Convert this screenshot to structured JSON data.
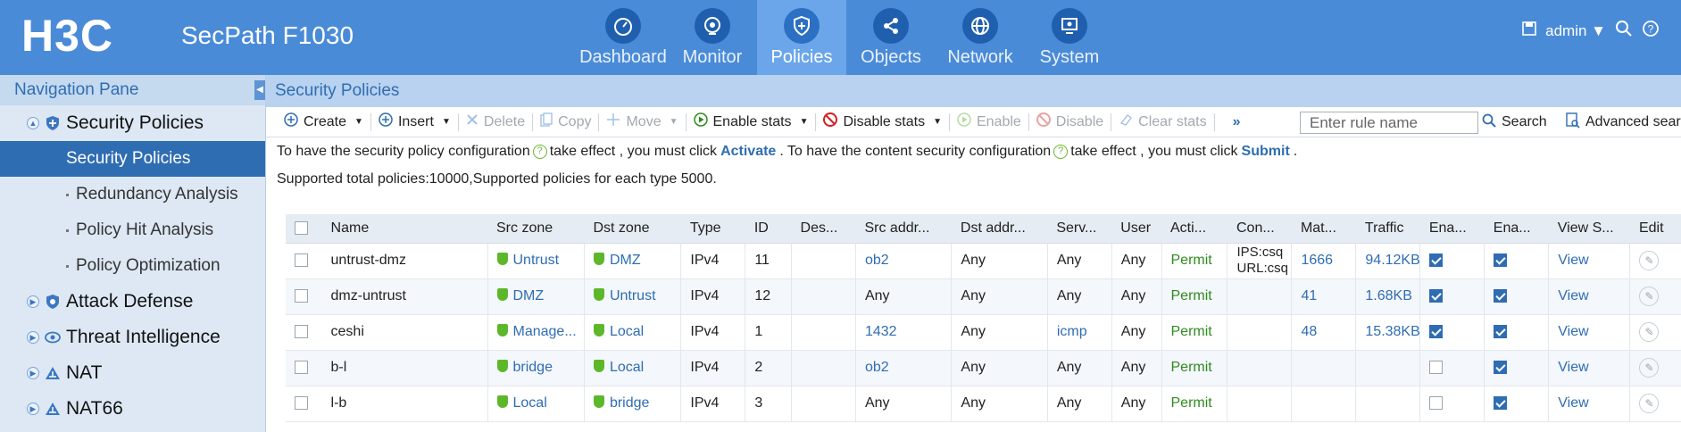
{
  "header": {
    "logo": "H3C",
    "product": "SecPath F1030",
    "nav": [
      {
        "label": "Dashboard",
        "icon": "dashboard-icon"
      },
      {
        "label": "Monitor",
        "icon": "monitor-icon"
      },
      {
        "label": "Policies",
        "icon": "policies-icon",
        "active": true
      },
      {
        "label": "Objects",
        "icon": "objects-icon"
      },
      {
        "label": "Network",
        "icon": "network-icon"
      },
      {
        "label": "System",
        "icon": "system-icon"
      }
    ],
    "user": "admin"
  },
  "sidebar": {
    "title": "Navigation Pane",
    "items": [
      {
        "label": "Security Policies",
        "level": 1
      },
      {
        "label": "Security Policies",
        "level": 2
      },
      {
        "label": "Redundancy Analysis",
        "level": 2
      },
      {
        "label": "Policy Hit Analysis",
        "level": 2
      },
      {
        "label": "Policy Optimization",
        "level": 2
      },
      {
        "label": "Attack Defense",
        "level": 1
      },
      {
        "label": "Threat Intelligence",
        "level": 1
      },
      {
        "label": "NAT",
        "level": 1
      },
      {
        "label": "NAT66",
        "level": 1
      }
    ]
  },
  "main": {
    "title": "Security Policies",
    "toolbar": {
      "create": "Create",
      "insert": "Insert",
      "delete": "Delete",
      "copy": "Copy",
      "move": "Move",
      "enable_stats": "Enable stats",
      "disable_stats": "Disable stats",
      "enable": "Enable",
      "disable": "Disable",
      "clear_stats": "Clear stats",
      "more": "»",
      "search_placeholder": "Enter rule name",
      "search": "Search",
      "advanced": "Advanced search"
    },
    "info": {
      "l1a": "To have the security policy configuration",
      "l1b": "take effect , you must click",
      "activate": "Activate",
      "l1c": ". To have the content security configuration",
      "l1d": "take effect , you must click",
      "submit": "Submit",
      "l1e": ".",
      "line2": "Supported total policies:10000,Supported policies for each type 5000."
    },
    "table": {
      "headers": [
        "Name",
        "Src zone",
        "Dst zone",
        "Type",
        "ID",
        "Des...",
        "Src addr...",
        "Dst addr...",
        "Serv...",
        "User",
        "Acti...",
        "Con...",
        "Mat...",
        "Traffic",
        "Ena...",
        "Ena...",
        "View S...",
        "Edit"
      ],
      "rows": [
        {
          "name": "untrust-dmz",
          "src": "Untrust",
          "dst": "DMZ",
          "type": "IPv4",
          "id": "11",
          "desc": "",
          "srcaddr": "ob2",
          "dstaddr": "Any",
          "serv": "Any",
          "user": "Any",
          "action": "Permit",
          "con1": "IPS:csq",
          "con2": "URL:csq",
          "match": "1666",
          "traffic": "94.12KB",
          "ena1": true,
          "ena2": true,
          "view": "View"
        },
        {
          "name": "dmz-untrust",
          "src": "DMZ",
          "dst": "Untrust",
          "type": "IPv4",
          "id": "12",
          "desc": "",
          "srcaddr": "Any",
          "dstaddr": "Any",
          "serv": "Any",
          "user": "Any",
          "action": "Permit",
          "con1": "",
          "con2": "",
          "match": "41",
          "traffic": "1.68KB",
          "ena1": true,
          "ena2": true,
          "view": "View"
        },
        {
          "name": "ceshi",
          "src": "Manage...",
          "dst": "Local",
          "type": "IPv4",
          "id": "1",
          "desc": "",
          "srcaddr": "1432",
          "dstaddr": "Any",
          "serv": "icmp",
          "user": "Any",
          "action": "Permit",
          "con1": "",
          "con2": "",
          "match": "48",
          "traffic": "15.38KB",
          "ena1": true,
          "ena2": true,
          "view": "View"
        },
        {
          "name": "b-l",
          "src": "bridge",
          "dst": "Local",
          "type": "IPv4",
          "id": "2",
          "desc": "",
          "srcaddr": "ob2",
          "dstaddr": "Any",
          "serv": "Any",
          "user": "Any",
          "action": "Permit",
          "con1": "",
          "con2": "",
          "match": "",
          "traffic": "",
          "ena1": false,
          "ena2": true,
          "view": "View"
        },
        {
          "name": "l-b",
          "src": "Local",
          "dst": "bridge",
          "type": "IPv4",
          "id": "3",
          "desc": "",
          "srcaddr": "Any",
          "dstaddr": "Any",
          "serv": "Any",
          "user": "Any",
          "action": "Permit",
          "con1": "",
          "con2": "",
          "match": "",
          "traffic": "",
          "ena1": false,
          "ena2": true,
          "view": "View"
        }
      ]
    }
  },
  "colors": {
    "header": "#4a8bd8",
    "accent": "#2f6db3",
    "permit": "#2e8b1f",
    "shield": "#5cb82a"
  }
}
